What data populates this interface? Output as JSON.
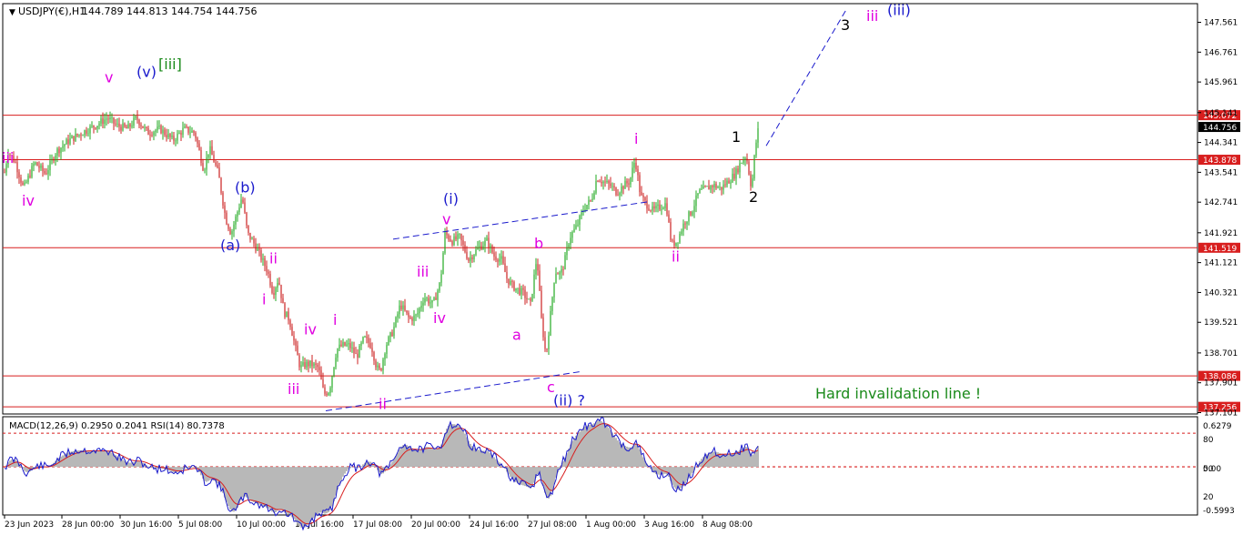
{
  "header": {
    "symbol": "USDJPY(€),H1",
    "ohlc": "144.789 144.813 144.754 144.756"
  },
  "indicator": {
    "header": "MACD(12,26,9) 0.2950 0.2041  RSI(14) 80.7378",
    "scale_labels": [
      "0.6279",
      "80",
      "0.00",
      "50",
      "20",
      "-0.5993"
    ],
    "macd_max": 0.6279,
    "macd_min": -0.5993,
    "rsi_levels": [
      80,
      50,
      20
    ]
  },
  "chart_data": {
    "type": "candlestick",
    "symbol": "USDJPY",
    "timeframe": "H1",
    "x_tick_labels": [
      "23 Jun 2023",
      "28 Jun 00:00",
      "30 Jun 16:00",
      "5 Jul 08:00",
      "10 Jul 00:00",
      "12 Jul 16:00",
      "17 Jul 08:00",
      "20 Jul 00:00",
      "24 Jul 16:00",
      "27 Jul 08:00",
      "1 Aug 00:00",
      "3 Aug 16:00",
      "8 Aug 08:00"
    ],
    "y_tick_labels": [
      "147.561",
      "146.761",
      "145.961",
      "145.141",
      "144.341",
      "143.541",
      "142.741",
      "141.921",
      "141.121",
      "140.321",
      "139.521",
      "138.701",
      "137.901",
      "137.101"
    ],
    "ylim": [
      137.101,
      147.561
    ],
    "price_path": [
      [
        0,
        144.0
      ],
      [
        4,
        143.4
      ],
      [
        9,
        144.1
      ],
      [
        17,
        143.8
      ],
      [
        26,
        143.1
      ],
      [
        38,
        143.8
      ],
      [
        50,
        143.5
      ],
      [
        62,
        144.1
      ],
      [
        76,
        144.4
      ],
      [
        90,
        144.6
      ],
      [
        105,
        144.8
      ],
      [
        118,
        145.0
      ],
      [
        128,
        144.8
      ],
      [
        140,
        144.7
      ],
      [
        150,
        145.0
      ],
      [
        162,
        144.6
      ],
      [
        176,
        144.7
      ],
      [
        190,
        144.4
      ],
      [
        202,
        144.7
      ],
      [
        214,
        144.6
      ],
      [
        224,
        143.6
      ],
      [
        230,
        144.2
      ],
      [
        240,
        143.5
      ],
      [
        248,
        142.3
      ],
      [
        254,
        141.9
      ],
      [
        260,
        142.4
      ],
      [
        266,
        142.9
      ],
      [
        272,
        141.9
      ],
      [
        280,
        141.6
      ],
      [
        288,
        141.2
      ],
      [
        294,
        140.9
      ],
      [
        300,
        140.3
      ],
      [
        306,
        140.7
      ],
      [
        312,
        139.8
      ],
      [
        318,
        139.6
      ],
      [
        324,
        138.9
      ],
      [
        330,
        138.3
      ],
      [
        336,
        138.4
      ],
      [
        342,
        138.4
      ],
      [
        350,
        138.3
      ],
      [
        356,
        137.6
      ],
      [
        362,
        137.7
      ],
      [
        370,
        138.8
      ],
      [
        376,
        138.9
      ],
      [
        384,
        138.9
      ],
      [
        392,
        138.6
      ],
      [
        400,
        139.1
      ],
      [
        408,
        138.9
      ],
      [
        414,
        138.3
      ],
      [
        418,
        138.2
      ],
      [
        424,
        138.9
      ],
      [
        432,
        139.3
      ],
      [
        440,
        140.0
      ],
      [
        450,
        139.6
      ],
      [
        458,
        139.7
      ],
      [
        466,
        140.2
      ],
      [
        476,
        140.0
      ],
      [
        484,
        140.6
      ],
      [
        489,
        141.9
      ],
      [
        497,
        141.7
      ],
      [
        505,
        141.8
      ],
      [
        515,
        141.2
      ],
      [
        525,
        141.5
      ],
      [
        535,
        141.7
      ],
      [
        543,
        141.3
      ],
      [
        551,
        141.2
      ],
      [
        557,
        140.7
      ],
      [
        563,
        140.5
      ],
      [
        569,
        140.4
      ],
      [
        575,
        140.3
      ],
      [
        583,
        140.0
      ],
      [
        590,
        141.3
      ],
      [
        595,
        139.6
      ],
      [
        600,
        138.6
      ],
      [
        604,
        139.5
      ],
      [
        610,
        140.9
      ],
      [
        616,
        140.8
      ],
      [
        620,
        141.1
      ],
      [
        626,
        141.8
      ],
      [
        634,
        142.1
      ],
      [
        642,
        142.6
      ],
      [
        650,
        142.8
      ],
      [
        656,
        143.4
      ],
      [
        662,
        143.3
      ],
      [
        670,
        143.2
      ],
      [
        678,
        143.0
      ],
      [
        686,
        143.2
      ],
      [
        692,
        143.3
      ],
      [
        698,
        143.9
      ],
      [
        704,
        142.9
      ],
      [
        710,
        142.7
      ],
      [
        718,
        142.5
      ],
      [
        724,
        142.6
      ],
      [
        732,
        142.7
      ],
      [
        738,
        141.6
      ],
      [
        744,
        141.7
      ],
      [
        752,
        142.2
      ],
      [
        760,
        142.5
      ],
      [
        768,
        143.0
      ],
      [
        776,
        143.1
      ],
      [
        784,
        143.2
      ],
      [
        792,
        143.1
      ],
      [
        800,
        143.3
      ],
      [
        808,
        143.5
      ],
      [
        814,
        143.8
      ],
      [
        820,
        144.0
      ],
      [
        826,
        143.1
      ],
      [
        830,
        144.2
      ],
      [
        834,
        144.8
      ]
    ],
    "horizontal_lines": [
      {
        "price": 145.072,
        "label": "145.072"
      },
      {
        "price": 143.878,
        "label": "143.878"
      },
      {
        "price": 141.519,
        "label": "141.519"
      },
      {
        "price": 138.086,
        "label": "138.086"
      },
      {
        "price": 137.256,
        "label": "137.256"
      }
    ],
    "current_price_label": "144.756",
    "current_price": 144.756,
    "annotation_text": "Hard invalidation line !",
    "wave_labels": [
      {
        "text": "iii",
        "color": "#e000e0",
        "x": 2,
        "p": 143.8
      },
      {
        "text": "iv",
        "color": "#e000e0",
        "x": 24,
        "p": 142.65
      },
      {
        "text": "v",
        "color": "#e000e0",
        "x": 115,
        "p": 145.95
      },
      {
        "text": "(v)",
        "color": "#1a1acc",
        "x": 150,
        "p": 146.1
      },
      {
        "text": "[iii]",
        "color": "#1a8a1a",
        "x": 174,
        "p": 146.3
      },
      {
        "text": "(b)",
        "color": "#1a1acc",
        "x": 258,
        "p": 143.0
      },
      {
        "text": "(a)",
        "color": "#1a1acc",
        "x": 242,
        "p": 141.45
      },
      {
        "text": "ii",
        "color": "#e000e0",
        "x": 296,
        "p": 141.1
      },
      {
        "text": "i",
        "color": "#e000e0",
        "x": 288,
        "p": 140.0
      },
      {
        "text": "iv",
        "color": "#e000e0",
        "x": 334,
        "p": 139.2
      },
      {
        "text": "iii",
        "color": "#e000e0",
        "x": 316,
        "p": 137.6
      },
      {
        "text": "i",
        "color": "#e000e0",
        "x": 366,
        "p": 139.45
      },
      {
        "text": "ii",
        "color": "#e000e0",
        "x": 416,
        "p": 137.2
      },
      {
        "text": "iii",
        "color": "#e000e0",
        "x": 458,
        "p": 140.75
      },
      {
        "text": "iv",
        "color": "#e000e0",
        "x": 476,
        "p": 139.5
      },
      {
        "text": "(i)",
        "color": "#1a1acc",
        "x": 487,
        "p": 142.7
      },
      {
        "text": "v",
        "color": "#e000e0",
        "x": 486,
        "p": 142.15
      },
      {
        "text": "b",
        "color": "#e000e0",
        "x": 587,
        "p": 141.5
      },
      {
        "text": "a",
        "color": "#e000e0",
        "x": 563,
        "p": 139.05
      },
      {
        "text": "c",
        "color": "#e000e0",
        "x": 601,
        "p": 137.65
      },
      {
        "text": "(ii) ?",
        "color": "#1a1acc",
        "x": 608,
        "p": 137.3
      },
      {
        "text": "i",
        "color": "#e000e0",
        "x": 697,
        "p": 144.3
      },
      {
        "text": "ii",
        "color": "#e000e0",
        "x": 738,
        "p": 141.15
      },
      {
        "text": "1",
        "color": "#000000",
        "x": 804,
        "p": 144.35
      },
      {
        "text": "2",
        "color": "#000000",
        "x": 823,
        "p": 142.75
      },
      {
        "text": "3",
        "color": "#000000",
        "x": 924,
        "p": 147.35
      },
      {
        "text": "iii",
        "color": "#e000e0",
        "x": 952,
        "p": 147.6
      },
      {
        "text": "(iii)",
        "color": "#1a1acc",
        "x": 975,
        "p": 147.75
      }
    ],
    "trend_lines": [
      {
        "x1": 432,
        "p1": 141.75,
        "x2": 712,
        "p2": 142.75
      },
      {
        "x1": 358,
        "p1": 137.15,
        "x2": 638,
        "p2": 138.2
      }
    ],
    "projection_line": {
      "x1": 842,
      "p1": 144.25,
      "x2": 930,
      "p2": 147.9
    },
    "colors": {
      "bull_candle": "#22aa22",
      "bear_candle": "#cc2020",
      "level_line": "#d81e1e",
      "trend_line": "#1a1acc",
      "annotation": "#1a8a1a",
      "macd_line": "#1a1acc",
      "signal_line": "#d81e1e",
      "histogram": "#b8b8b8",
      "price_label_bg": "#d81e1e",
      "current_label_bg": "#000000"
    }
  }
}
